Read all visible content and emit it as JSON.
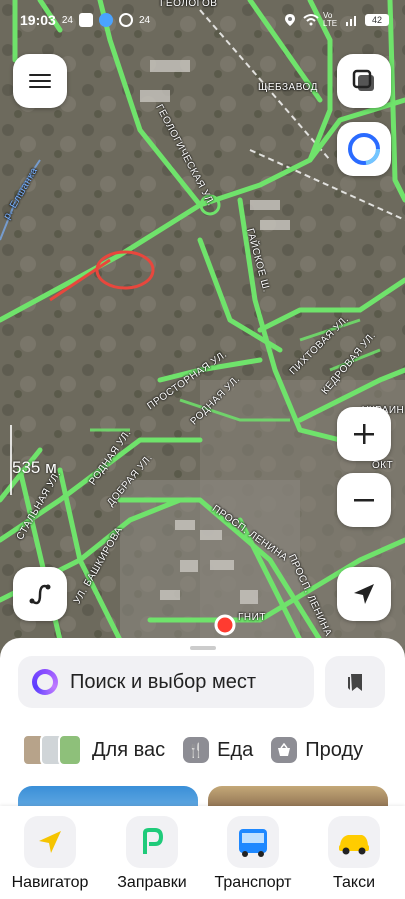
{
  "status_bar": {
    "time": "19:03",
    "notif_count": "24",
    "badge_count": "24",
    "network_label": "Vo LTE",
    "battery": "42"
  },
  "map": {
    "labels": {
      "geologov": "ГЕОЛОГОВ",
      "shchebzavod": "ЩЕБЗАВОД",
      "geologicheskaya": "ГЕОЛОГИЧЕСКАЯ УЛ.",
      "elshanka": "р. Елшанка",
      "gayskoe": "ГАЙСКОЕ Ш.",
      "pikhtovaya": "ПИХТОВАЯ УЛ.",
      "kedrovaya": "КЕДРОВАЯ УЛ.",
      "prostornaya": "ПРОСТОРНАЯ УЛ.",
      "rodnaya": "РОДНАЯ УЛ.",
      "rodnaya2": "РОДНАЯ УЛ.",
      "dobraya": "ДОБРАЯ УЛ.",
      "stalnaya": "СТАЛЬНАЯ УЛ.",
      "bashkirova": "УЛ. БАШКИРОВА",
      "prosp_lenina": "ПРОСП. ЛЕНИНА",
      "prosp_lenina2": "ПРОСП. ЛЕНИНА",
      "magnit": "ГНИТ",
      "okt": "ОКТ",
      "ukrain": "УКРАИН"
    },
    "scale": "535 м"
  },
  "search": {
    "placeholder": "Поиск и выбор мест"
  },
  "categories": [
    {
      "label": "Для вас"
    },
    {
      "label": "Еда"
    },
    {
      "label": "Проду"
    }
  ],
  "nav": [
    {
      "label": "Навигатор"
    },
    {
      "label": "Заправки"
    },
    {
      "label": "Транспорт"
    },
    {
      "label": "Такси"
    }
  ],
  "colors": {
    "road": "#6fe36b",
    "accent": "#ff3b30",
    "route": "#e8473d",
    "alice": "#8a4dff"
  }
}
